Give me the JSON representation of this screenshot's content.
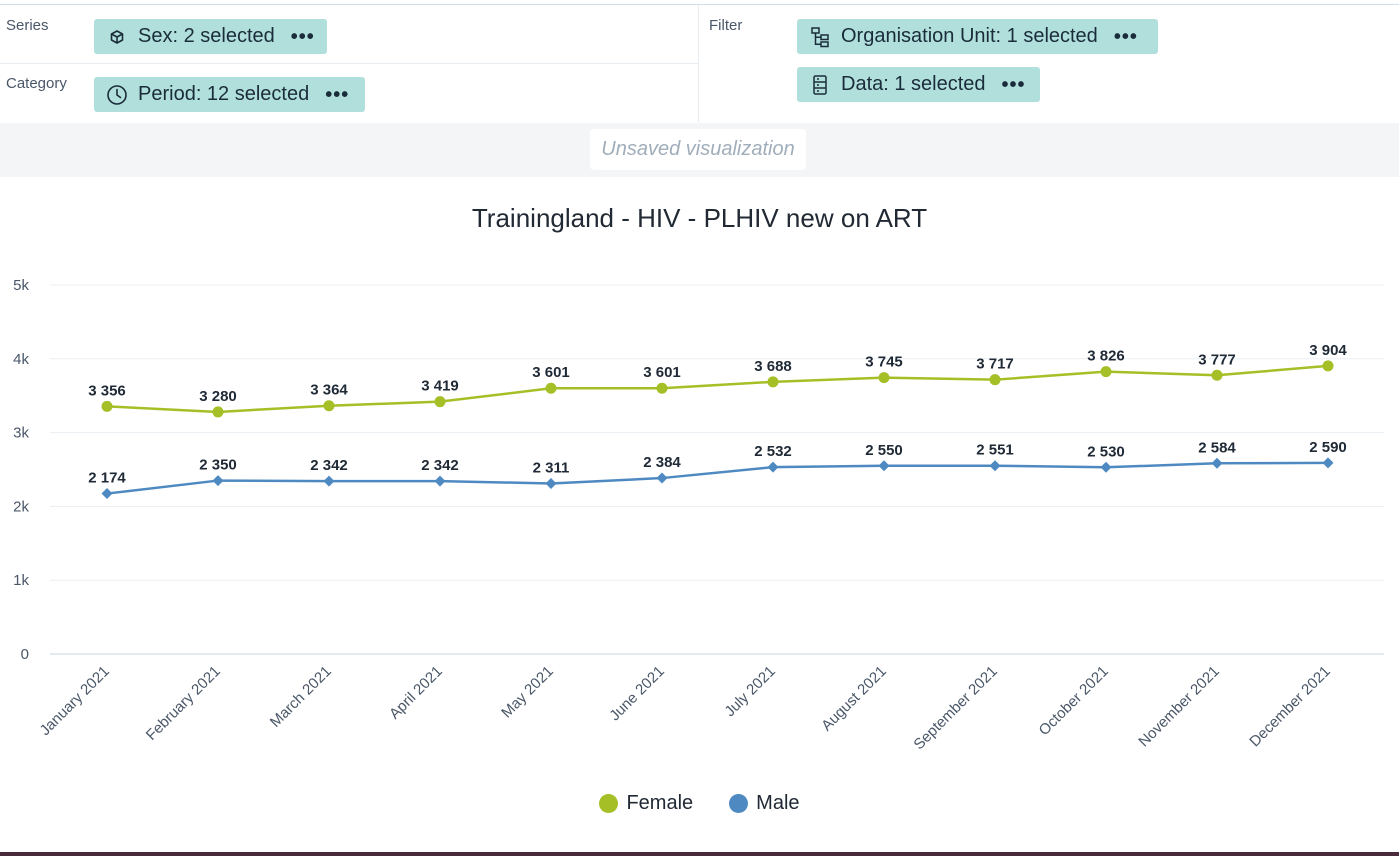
{
  "layout": {
    "series_label": "Series",
    "category_label": "Category",
    "filter_label": "Filter",
    "chips": {
      "sex": {
        "label": "Sex: 2 selected",
        "icon": "cube-icon"
      },
      "period": {
        "label": "Period: 12 selected",
        "icon": "clock-icon"
      },
      "org_unit": {
        "label": "Organisation Unit: 1 selected",
        "icon": "hierarchy-icon"
      },
      "data": {
        "label": "Data: 1 selected",
        "icon": "database-icon"
      }
    },
    "more_glyph": "•••"
  },
  "status": {
    "unsaved": "Unsaved visualization"
  },
  "colors": {
    "chip": "#b1e0dc",
    "female": "#a5bf26",
    "male": "#4e8ac1"
  },
  "chart_data": {
    "type": "line",
    "title": "Trainingland - HIV - PLHIV new on ART",
    "categories": [
      "January 2021",
      "February 2021",
      "March 2021",
      "April 2021",
      "May 2021",
      "June 2021",
      "July 2021",
      "August 2021",
      "September 2021",
      "October 2021",
      "November 2021",
      "December 2021"
    ],
    "yticks": [
      "0",
      "1k",
      "2k",
      "3k",
      "4k",
      "5k"
    ],
    "ylim": [
      0,
      5000
    ],
    "grid": true,
    "legend_position": "bottom",
    "series": [
      {
        "name": "Female",
        "color": "#a5bf26",
        "marker": "circle",
        "values": [
          3356,
          3280,
          3364,
          3419,
          3601,
          3601,
          3688,
          3745,
          3717,
          3826,
          3777,
          3904
        ],
        "labels": [
          "3 356",
          "3 280",
          "3 364",
          "3 419",
          "3 601",
          "3 601",
          "3 688",
          "3 745",
          "3 717",
          "3 826",
          "3 777",
          "3 904"
        ]
      },
      {
        "name": "Male",
        "color": "#4e8ac1",
        "marker": "diamond",
        "values": [
          2174,
          2350,
          2342,
          2342,
          2311,
          2384,
          2532,
          2550,
          2551,
          2530,
          2584,
          2590
        ],
        "labels": [
          "2 174",
          "2 350",
          "2 342",
          "2 342",
          "2 311",
          "2 384",
          "2 532",
          "2 550",
          "2 551",
          "2 530",
          "2 584",
          "2 590"
        ]
      }
    ]
  }
}
